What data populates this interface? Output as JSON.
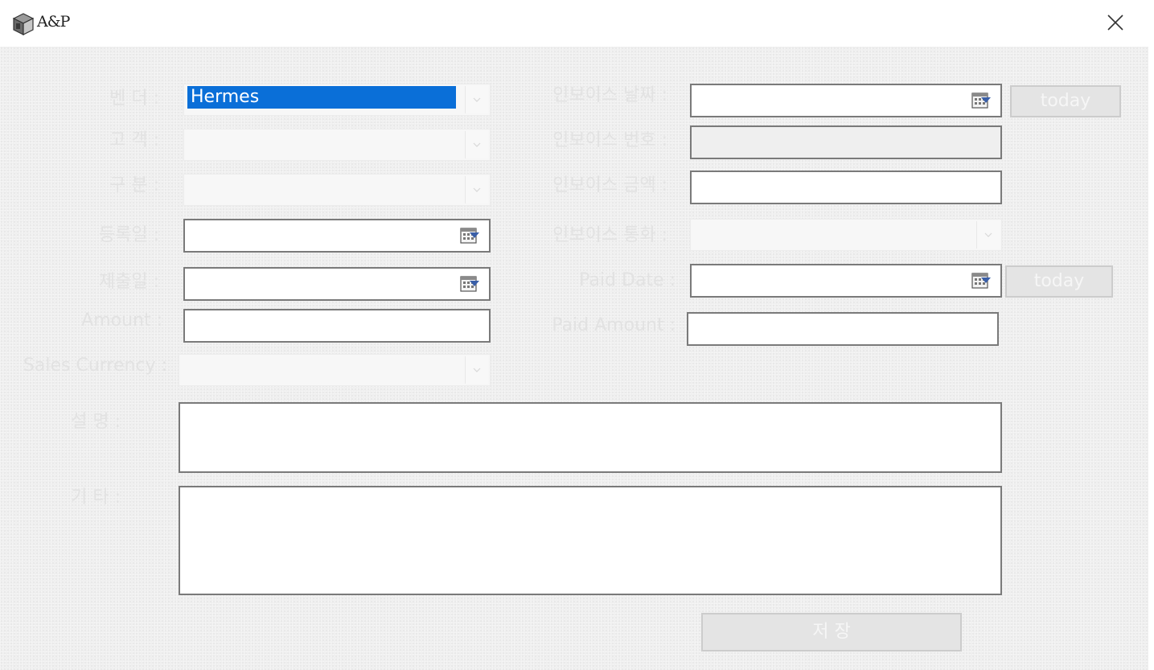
{
  "window": {
    "title": "A&P"
  },
  "labels": {
    "vendor": "벤 더 :",
    "customer": "고 객 :",
    "category": "구 분 :",
    "reg_date": "등록일 :",
    "submit_date": "제출일 :",
    "amount": "Amount :",
    "sales_currency": "Sales Currency :",
    "description": "설 명 :",
    "etc": "기 타 :",
    "invoice_date": "인보이스 날짜 :",
    "invoice_number": "인보이스 번호 :",
    "invoice_amount": "인보이스 금액 :",
    "invoice_currency": "인보이스 통화 :",
    "paid_date": "Paid Date :",
    "paid_amount": "Paid Amount :"
  },
  "fields": {
    "vendor_value": "Hermes"
  },
  "buttons": {
    "today_invoice": "today",
    "today_paid": "today",
    "save": "저 장"
  }
}
